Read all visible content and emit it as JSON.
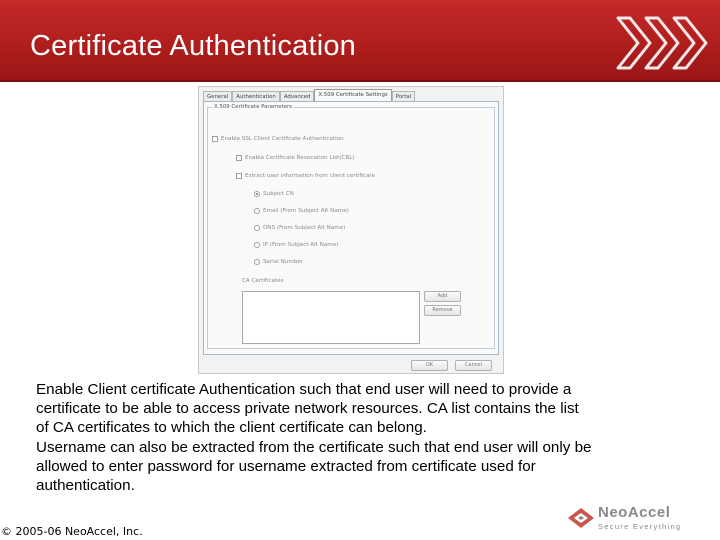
{
  "slide": {
    "title": "Certificate Authentication",
    "body_lines": [
      "Enable Client certificate Authentication such that end user will need to provide a",
      "certificate to be able to access private network resources. CA list contains the list",
      "of CA certificates to which the client certificate can belong.",
      "Username can also be extracted from the certificate such that end user will only be",
      "allowed to enter password for username extracted from certificate used for",
      "authentication."
    ],
    "copyright": "© 2005-06 NeoAccel, Inc."
  },
  "logo": {
    "name": "NeoAccel",
    "tagline": "Secure Everything"
  },
  "dialog": {
    "tabs": [
      "General",
      "Authentication",
      "Advanced",
      "X.509 Certificate Settings",
      "Portal"
    ],
    "active_tab": "X.509 Certificate Settings",
    "group_title": "X.509 Certificate Parameters",
    "enable_ssl_label": "Enable SSL Client Certificate Authentication",
    "enable_crl_label": "Enable Certificate Revocation List(CRL)",
    "extract_user_label": "Extract user information from client certificate",
    "radio_options": [
      "Subject CN",
      "Email (From Subject Alt Name)",
      "DNS (From Subject Alt Name)",
      "IP (From Subject Alt Name)",
      "Serial Number"
    ],
    "selected_radio": "Subject CN",
    "ca_label": "CA Certificates",
    "add_label": "Add",
    "remove_label": "Remove",
    "ok_label": "OK",
    "cancel_label": "Cancel"
  },
  "colors": {
    "header_red": "#b01e1e",
    "logo_red": "#c0392b",
    "logo_gray": "#8a8a8a"
  }
}
